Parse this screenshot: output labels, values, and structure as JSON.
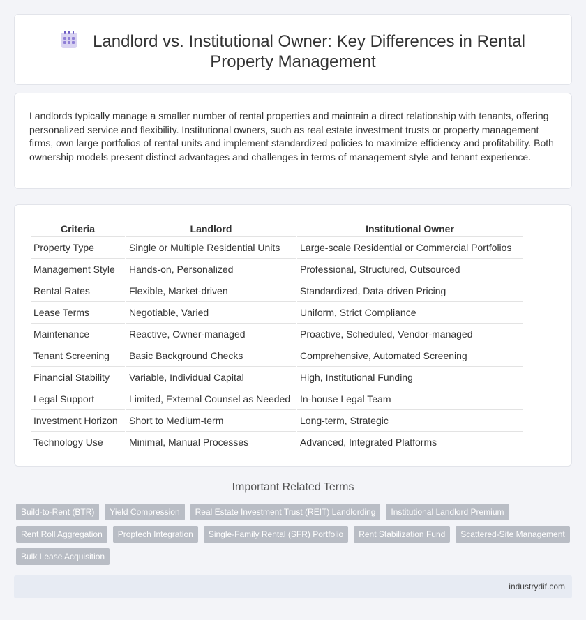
{
  "header": {
    "title_line1": "Landlord vs. Institutional Owner: Key Differences in Rental",
    "title_line2": "Property Management",
    "icon": "calendar-icon"
  },
  "intro": {
    "text": "Landlords typically manage a smaller number of rental properties and maintain a direct relationship with tenants, offering personalized service and flexibility. Institutional owners, such as real estate investment trusts or property management firms, own large portfolios of rental units and implement standardized policies to maximize efficiency and profitability. Both ownership models present distinct advantages and challenges in terms of management style and tenant experience."
  },
  "table": {
    "headers": [
      "Criteria",
      "Landlord",
      "Institutional Owner"
    ],
    "rows": [
      [
        "Property Type",
        "Single or Multiple Residential Units",
        "Large-scale Residential or Commercial Portfolios"
      ],
      [
        "Management Style",
        "Hands-on, Personalized",
        "Professional, Structured, Outsourced"
      ],
      [
        "Rental Rates",
        "Flexible, Market-driven",
        "Standardized, Data-driven Pricing"
      ],
      [
        "Lease Terms",
        "Negotiable, Varied",
        "Uniform, Strict Compliance"
      ],
      [
        "Maintenance",
        "Reactive, Owner-managed",
        "Proactive, Scheduled, Vendor-managed"
      ],
      [
        "Tenant Screening",
        "Basic Background Checks",
        "Comprehensive, Automated Screening"
      ],
      [
        "Financial Stability",
        "Variable, Individual Capital",
        "High, Institutional Funding"
      ],
      [
        "Legal Support",
        "Limited, External Counsel as Needed",
        "In-house Legal Team"
      ],
      [
        "Investment Horizon",
        "Short to Medium-term",
        "Long-term, Strategic"
      ],
      [
        "Technology Use",
        "Minimal, Manual Processes",
        "Advanced, Integrated Platforms"
      ]
    ]
  },
  "related": {
    "title": "Important Related Terms",
    "tags": [
      "Build-to-Rent (BTR)",
      "Yield Compression",
      "Real Estate Investment Trust (REIT) Landlording",
      "Institutional Landlord Premium",
      "Rent Roll Aggregation",
      "Proptech Integration",
      "Single-Family Rental (SFR) Portfolio",
      "Rent Stabilization Fund",
      "Scattered-Site Management",
      "Bulk Lease Acquisition"
    ]
  },
  "footer": {
    "site": "industrydif.com"
  }
}
